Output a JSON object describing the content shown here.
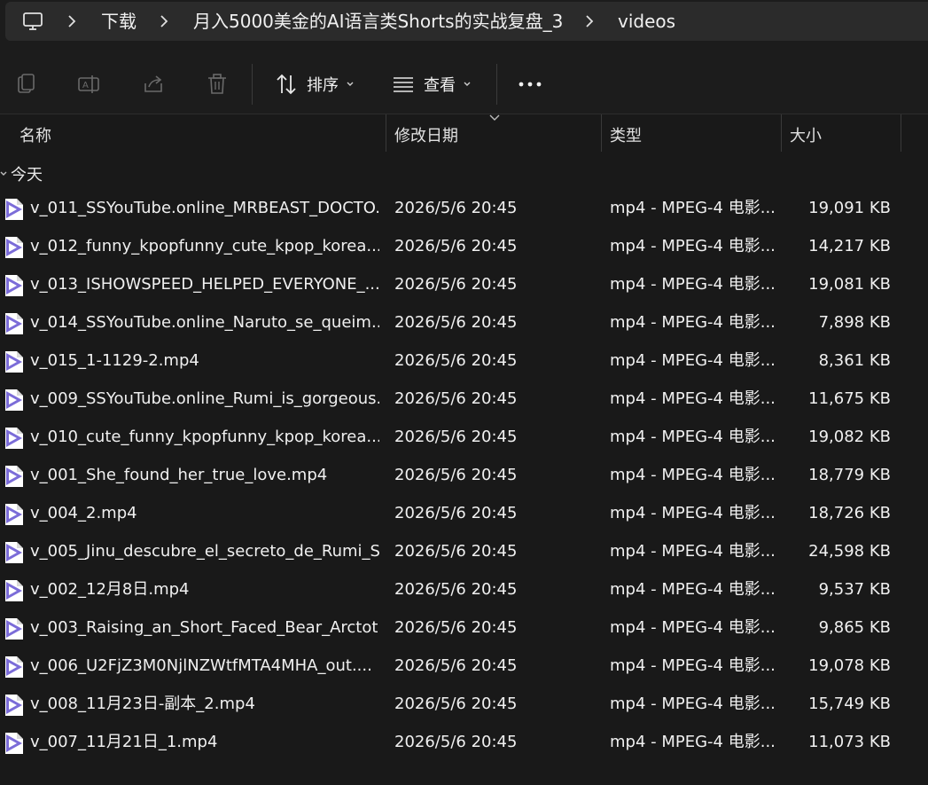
{
  "address_bar": {
    "crumbs": [
      "下载",
      "月入5000美金的AI语言类Shorts的实战复盘_3",
      "videos"
    ]
  },
  "toolbar": {
    "sort_label": "排序",
    "view_label": "查看",
    "more_label": "•••"
  },
  "columns": {
    "name": "名称",
    "date": "修改日期",
    "type": "类型",
    "size": "大小"
  },
  "group": {
    "label": "今天"
  },
  "files": [
    {
      "name": "v_011_SSYouTube.online_MRBEAST_DOCTO...",
      "date": "2026/5/6 20:45",
      "type": "mp4 - MPEG-4 电影...",
      "size": "19,091 KB"
    },
    {
      "name": "v_012_funny_kpopfunny_cute_kpop_korea....",
      "date": "2026/5/6 20:45",
      "type": "mp4 - MPEG-4 电影...",
      "size": "14,217 KB"
    },
    {
      "name": "v_013_ISHOWSPEED_HELPED_EVERYONE_...",
      "date": "2026/5/6 20:45",
      "type": "mp4 - MPEG-4 电影...",
      "size": "19,081 KB"
    },
    {
      "name": "v_014_SSYouTube.online_Naruto_se_queim...",
      "date": "2026/5/6 20:45",
      "type": "mp4 - MPEG-4 电影...",
      "size": "7,898 KB"
    },
    {
      "name": "v_015_1-1129-2.mp4",
      "date": "2026/5/6 20:45",
      "type": "mp4 - MPEG-4 电影...",
      "size": "8,361 KB"
    },
    {
      "name": "v_009_SSYouTube.online_Rumi_is_gorgeous...",
      "date": "2026/5/6 20:45",
      "type": "mp4 - MPEG-4 电影...",
      "size": "11,675 KB"
    },
    {
      "name": "v_010_cute_funny_kpopfunny_kpop_korea....",
      "date": "2026/5/6 20:45",
      "type": "mp4 - MPEG-4 电影...",
      "size": "19,082 KB"
    },
    {
      "name": "v_001_She_found_her_true_love.mp4",
      "date": "2026/5/6 20:45",
      "type": "mp4 - MPEG-4 电影...",
      "size": "18,779 KB"
    },
    {
      "name": "v_004_2.mp4",
      "date": "2026/5/6 20:45",
      "type": "mp4 - MPEG-4 电影...",
      "size": "18,726 KB"
    },
    {
      "name": "v_005_Jinu_descubre_el_secreto_de_Rumi_S...",
      "date": "2026/5/6 20:45",
      "type": "mp4 - MPEG-4 电影...",
      "size": "24,598 KB"
    },
    {
      "name": "v_002_12月8日.mp4",
      "date": "2026/5/6 20:45",
      "type": "mp4 - MPEG-4 电影...",
      "size": "9,537 KB"
    },
    {
      "name": "v_003_Raising_an_Short_Faced_Bear_Arctot...",
      "date": "2026/5/6 20:45",
      "type": "mp4 - MPEG-4 电影...",
      "size": "9,865 KB"
    },
    {
      "name": "v_006_U2FjZ3M0NjlNZWtfMTA4MHA_out....",
      "date": "2026/5/6 20:45",
      "type": "mp4 - MPEG-4 电影...",
      "size": "19,078 KB"
    },
    {
      "name": "v_008_11月23日-副本_2.mp4",
      "date": "2026/5/6 20:45",
      "type": "mp4 - MPEG-4 电影...",
      "size": "15,749 KB"
    },
    {
      "name": "v_007_11月21日_1.mp4",
      "date": "2026/5/6 20:45",
      "type": "mp4 - MPEG-4 电影...",
      "size": "11,073 KB"
    }
  ],
  "icons": {
    "computer": "computer-icon",
    "crumb_separator": "chevron-right-icon",
    "copy": "copy-icon",
    "rename": "rename-icon",
    "share": "share-icon",
    "delete": "delete-icon",
    "sort": "sort-icon",
    "view": "view-icon",
    "file": "video-file-icon"
  },
  "colors": {
    "background": "#191919",
    "address_bar": "#2b2b2b",
    "video_icon": "#7b6cd8"
  }
}
